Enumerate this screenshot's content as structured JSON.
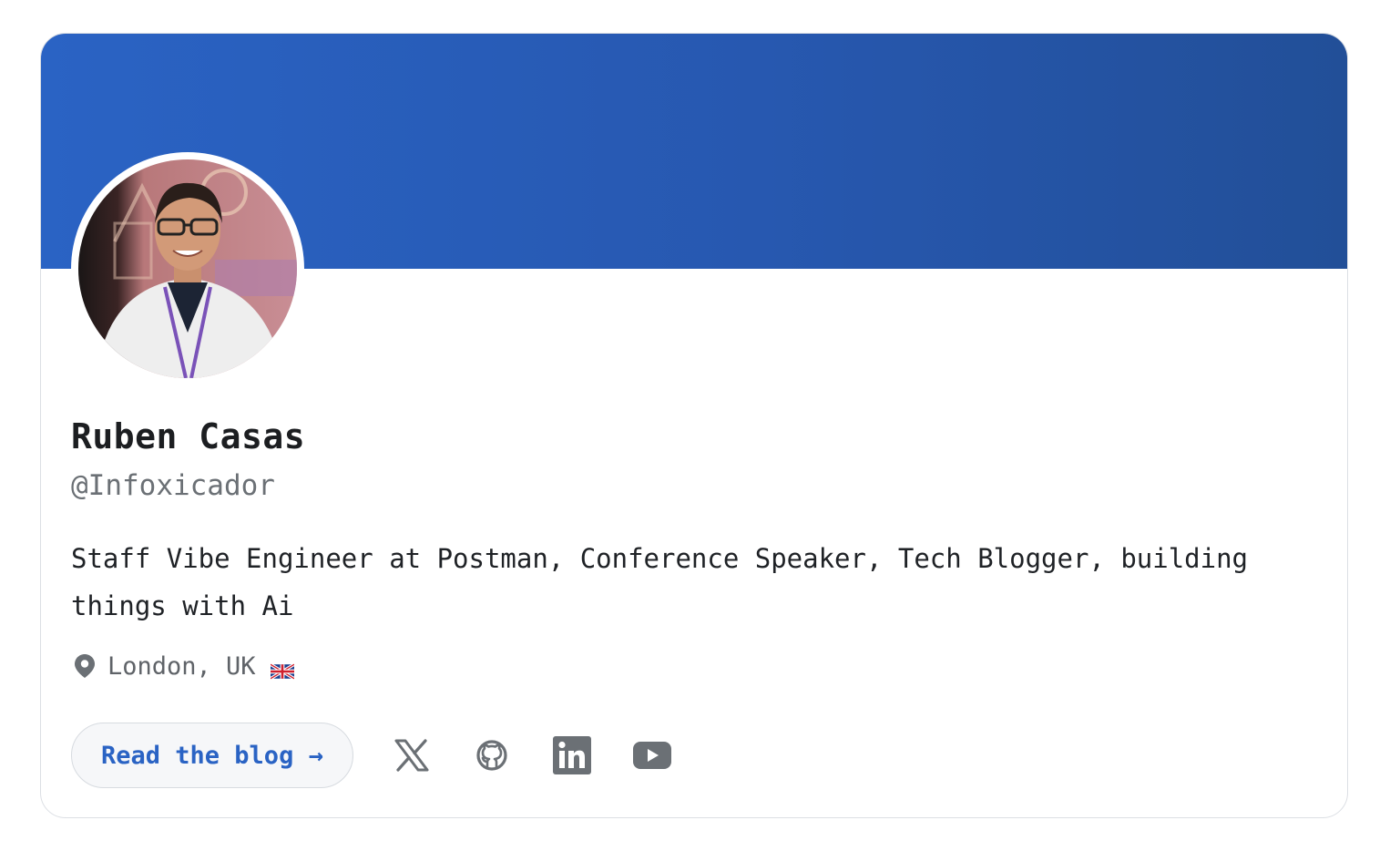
{
  "profile": {
    "name": "Ruben Casas",
    "handle": "@Infoxicador",
    "bio": "Staff Vibe Engineer at Postman, Conference Speaker, Tech Blogger, building things with Ai",
    "location": "London, UK",
    "location_icon": "map-pin-icon",
    "flag_icon": "uk-flag-icon"
  },
  "actions": {
    "blog_label": "Read the blog →",
    "social": [
      {
        "icon": "x-twitter-icon"
      },
      {
        "icon": "github-icon"
      },
      {
        "icon": "linkedin-icon"
      },
      {
        "icon": "youtube-icon"
      }
    ]
  },
  "colors": {
    "banner": "#2a63c4",
    "accent": "#2a63c4",
    "icon": "#6b7075"
  }
}
